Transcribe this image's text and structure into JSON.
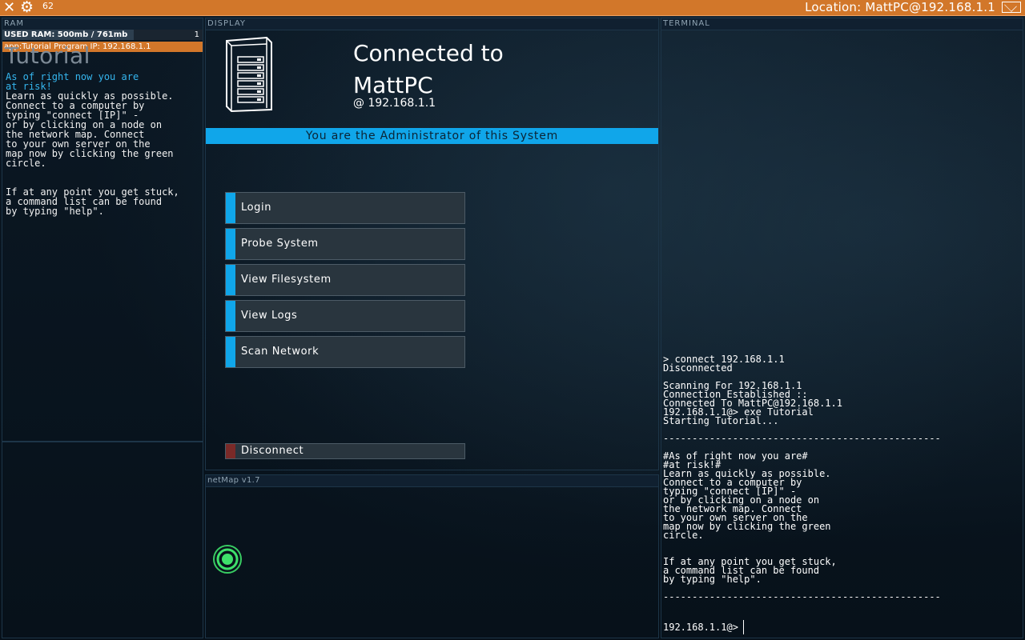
{
  "topbar": {
    "fps": "62",
    "location": "Location: MattPC@192.168.1.1"
  },
  "ram": {
    "title": "RAM",
    "used_text": "USED RAM: 500mb / 761mb",
    "used_fraction": 0.657,
    "process_count": "1",
    "app_label": "app:Tutorial Program  IP: 192.168.1.1"
  },
  "tutorial": {
    "title": "Tutorial",
    "highlight": "As of right now you are\nat risk!",
    "body": "\nLearn as quickly as possible.\nConnect to a computer by\ntyping \"connect [IP]\" -\nor by clicking on a node on\nthe network map. Connect\nto your own server on the\nmap now by clicking the green\ncircle.\n\n\nIf at any point you get stuck,\na command list can be found\nby typing \"help\"."
  },
  "display": {
    "title": "DISPLAY",
    "connected_line1": "Connected to",
    "connected_line2": "MattPC",
    "ip_line": "@  192.168.1.1",
    "admin_banner": "You are the Administrator of this System",
    "buttons": [
      {
        "label": "Login"
      },
      {
        "label": "Probe System"
      },
      {
        "label": "View Filesystem"
      },
      {
        "label": "View Logs"
      },
      {
        "label": "Scan Network"
      }
    ],
    "disconnect": "Disconnect"
  },
  "netmap": {
    "title": "netMap v1.7"
  },
  "terminal": {
    "title": "TERMINAL",
    "log": "> connect 192.168.1.1\nDisconnected\n\nScanning For 192.168.1.1\nConnection Established ::\nConnected To MattPC@192.168.1.1\n192.168.1.1@> exe Tutorial\nStarting Tutorial...\n\n------------------------------------------------\n\n#As of right now you are#\n#at risk!#\nLearn as quickly as possible.\nConnect to a computer by\ntyping \"connect [IP]\" -\nor by clicking on a node on\nthe network map. Connect\nto your own server on the\nmap now by clicking the green\ncircle.\n\n\nIf at any point you get stuck,\na command list can be found\nby typing \"help\".\n\n------------------------------------------------",
    "prompt": "192.168.1.1@>"
  },
  "colors": {
    "topbar": "#d2772a",
    "accent": "#10a6ea",
    "node": "#3ee06a",
    "disconnect": "#7a2a28"
  }
}
